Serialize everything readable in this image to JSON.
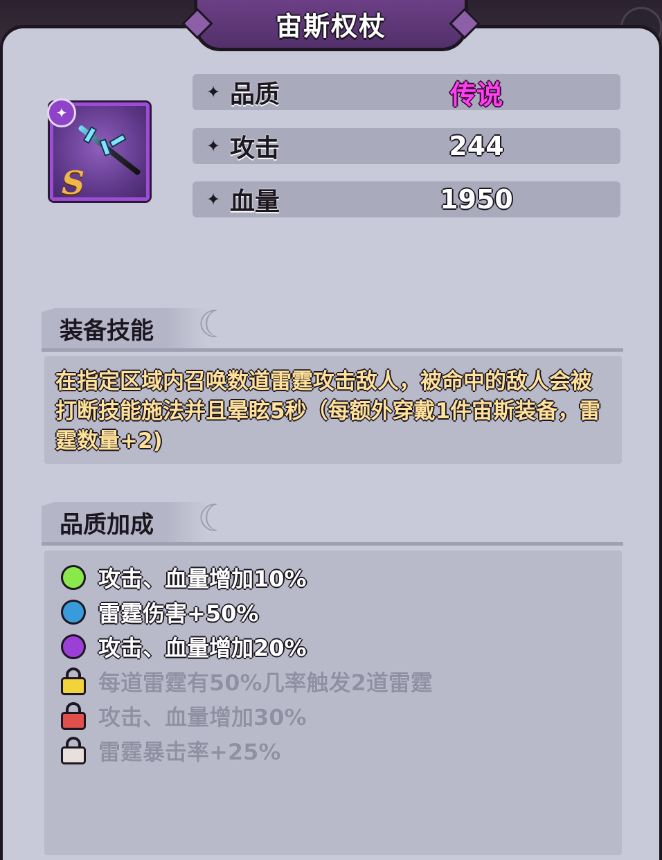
{
  "title": "宙斯权杖",
  "item": {
    "grade": "S",
    "badge_icon": "scepter-icon"
  },
  "stats": [
    {
      "label": "品质",
      "value": "传说"
    },
    {
      "label": "攻击",
      "value": "244"
    },
    {
      "label": "血量",
      "value": "1950"
    }
  ],
  "skill_section": {
    "header": "装备技能",
    "description": "在指定区域内召唤数道雷霆攻击敌人，被命中的敌人会被打断技能施法并且晕眩5秒（每额外穿戴1件宙斯装备，雷霆数量+2)"
  },
  "quality_section": {
    "header": "品质加成",
    "bonuses": [
      {
        "text": "攻击、血量增加10%",
        "state": "unlocked",
        "color": "#8be84a"
      },
      {
        "text": "雷霆伤害+50%",
        "state": "unlocked",
        "color": "#3a9bdc"
      },
      {
        "text": "攻击、血量增加20%",
        "state": "unlocked",
        "color": "#9b3fd6"
      },
      {
        "text": "每道雷霆有50%几率触发2道雷霆",
        "state": "locked",
        "color": "#f2d43a"
      },
      {
        "text": "攻击、血量增加30%",
        "state": "locked",
        "color": "#e2504e"
      },
      {
        "text": "雷霆暴击率+25%",
        "state": "locked",
        "color": "#e8e0dc"
      }
    ]
  },
  "colors": {
    "legend_quality": "#ff3ff0",
    "panel_bg": "#c9cad9",
    "skill_text": "#ffe19a"
  }
}
